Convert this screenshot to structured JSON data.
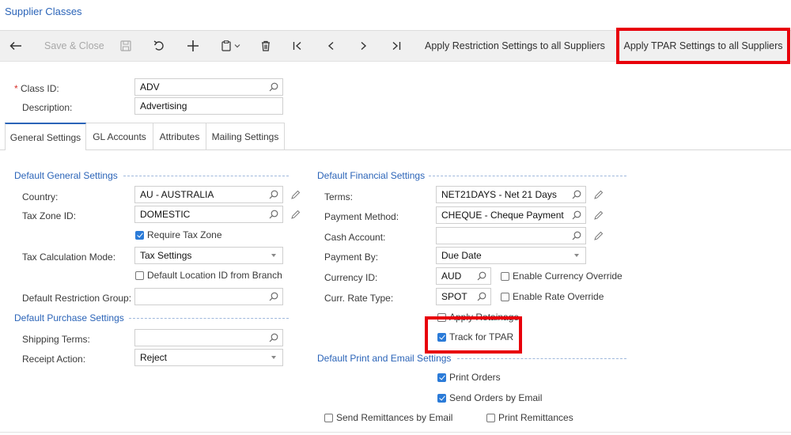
{
  "page": {
    "title": "Supplier Classes"
  },
  "toolbar": {
    "save_close_label": "Save & Close",
    "apply_restriction_label": "Apply Restriction Settings to all Suppliers",
    "apply_tpar_label": "Apply TPAR Settings to all Suppliers"
  },
  "header": {
    "class_id_label": "Class ID:",
    "class_id_value": "ADV",
    "description_label": "Description:",
    "description_value": "Advertising"
  },
  "tabs": [
    {
      "label": "General Settings"
    },
    {
      "label": "GL Accounts"
    },
    {
      "label": "Attributes"
    },
    {
      "label": "Mailing Settings"
    }
  ],
  "general": {
    "section_title": "Default General Settings",
    "country_label": "Country:",
    "country_value": "AU - AUSTRALIA",
    "tax_zone_label": "Tax Zone ID:",
    "tax_zone_value": "DOMESTIC",
    "require_tax_zone_label": "Require Tax Zone",
    "require_tax_zone_checked": true,
    "tax_calc_label": "Tax Calculation Mode:",
    "tax_calc_value": "Tax Settings",
    "default_location_label": "Default Location ID from Branch",
    "default_location_checked": false,
    "restriction_group_label": "Default Restriction Group:",
    "restriction_group_value": ""
  },
  "purchase": {
    "section_title": "Default Purchase Settings",
    "shipping_terms_label": "Shipping Terms:",
    "shipping_terms_value": "",
    "receipt_action_label": "Receipt Action:",
    "receipt_action_value": "Reject"
  },
  "financial": {
    "section_title": "Default Financial Settings",
    "terms_label": "Terms:",
    "terms_value": "NET21DAYS - Net 21 Days",
    "payment_method_label": "Payment Method:",
    "payment_method_value": "CHEQUE - Cheque Payment",
    "cash_account_label": "Cash Account:",
    "cash_account_value": "",
    "payment_by_label": "Payment By:",
    "payment_by_value": "Due Date",
    "currency_label": "Currency ID:",
    "currency_value": "AUD",
    "enable_currency_override_label": "Enable Currency Override",
    "enable_currency_override_checked": false,
    "rate_type_label": "Curr. Rate Type:",
    "rate_type_value": "SPOT",
    "enable_rate_override_label": "Enable Rate Override",
    "enable_rate_override_checked": false,
    "apply_retainage_label": "Apply Retainage",
    "apply_retainage_checked": false,
    "track_tpar_label": "Track for TPAR",
    "track_tpar_checked": true
  },
  "print_email": {
    "section_title": "Default Print and Email Settings",
    "print_orders_label": "Print Orders",
    "print_orders_checked": true,
    "send_orders_label": "Send Orders by Email",
    "send_orders_checked": true,
    "send_remittances_label": "Send Remittances by Email",
    "send_remittances_checked": false,
    "print_remittances_label": "Print Remittances",
    "print_remittances_checked": false
  },
  "colors": {
    "accent": "#2b64b8",
    "highlight": "#e8000b",
    "checkbox": "#2b7bd8"
  }
}
